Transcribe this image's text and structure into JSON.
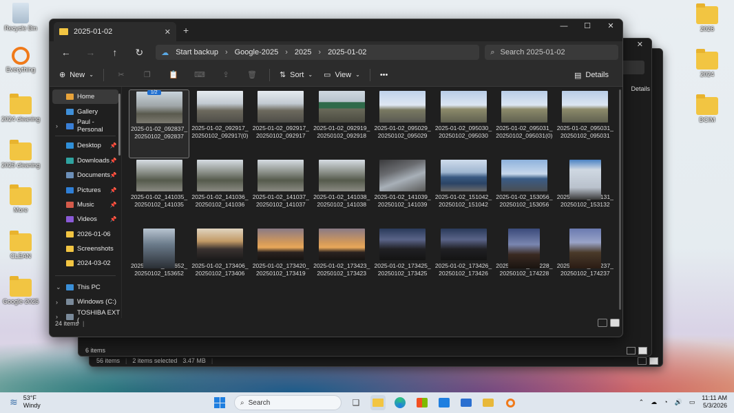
{
  "desktop_icons": [
    {
      "label": "Recycle Bin",
      "type": "recycle"
    },
    {
      "label": "Everything",
      "type": "app"
    },
    {
      "label": "2024 cleaning",
      "type": "folder"
    },
    {
      "label": "2025 cleaning",
      "type": "folder"
    },
    {
      "label": "More",
      "type": "folder"
    },
    {
      "label": "CLEAN",
      "type": "folder"
    },
    {
      "label": "Google-2025",
      "type": "folder"
    },
    {
      "label": "2026",
      "type": "folder"
    },
    {
      "label": "2024",
      "type": "folder"
    },
    {
      "label": "DCIM",
      "type": "folder"
    }
  ],
  "window": {
    "tab_title": "2025-01-02",
    "breadcrumbs": [
      "Start backup",
      "Google-2025",
      "2025",
      "2025-01-02"
    ],
    "search_placeholder": "Search 2025-01-02",
    "toolbar": {
      "new": "New",
      "sort": "Sort",
      "view": "View",
      "more": "•••",
      "details": "Details"
    },
    "status": "24 items"
  },
  "nav": {
    "pinned": [
      {
        "label": "Home",
        "selected": true,
        "color": "#e8a33a"
      },
      {
        "label": "Gallery",
        "color": "#3f8fd8"
      },
      {
        "label": "Paul - Personal",
        "color": "#3a7fd6",
        "expand": true
      }
    ],
    "quick": [
      {
        "label": "Desktop",
        "color": "#2f8fd8",
        "pin": true
      },
      {
        "label": "Downloads",
        "color": "#2fa3a0",
        "pin": true
      },
      {
        "label": "Documents",
        "color": "#6c8fb8",
        "pin": true
      },
      {
        "label": "Pictures",
        "color": "#2f7fd6",
        "pin": true
      },
      {
        "label": "Music",
        "color": "#d45a4a",
        "pin": true
      },
      {
        "label": "Videos",
        "color": "#8a5ad6",
        "pin": true
      },
      {
        "label": "2026-01-06",
        "color": "#f2c542"
      },
      {
        "label": "Screenshots",
        "color": "#f2c542"
      },
      {
        "label": "2024-03-02",
        "color": "#f2c542"
      }
    ],
    "drives": [
      {
        "label": "This PC",
        "color": "#3a8fd8",
        "expand": "open"
      },
      {
        "label": "Windows (C:)",
        "color": "#7a8a9a",
        "expand": true
      },
      {
        "label": "TOSHIBA EXT (",
        "color": "#7a8a9a",
        "expand": true
      }
    ]
  },
  "files": [
    {
      "name": "2025-01-02_092837_20250102_092837",
      "scene": "trees",
      "selected": true,
      "badge": "1/2"
    },
    {
      "name": "2025-01-02_092917_20250102_092917(0)",
      "scene": "highway"
    },
    {
      "name": "2025-01-02_092917_20250102_092917",
      "scene": "highway"
    },
    {
      "name": "2025-01-02_092919_20250102_092918",
      "scene": "sign"
    },
    {
      "name": "2025-01-02_095029_20250102_095029",
      "scene": "road-green"
    },
    {
      "name": "2025-01-02_095030_20250102_095030",
      "scene": "field"
    },
    {
      "name": "2025-01-02_095031_20250102_095031(0)",
      "scene": "field"
    },
    {
      "name": "2025-01-02_095031_20250102_095031",
      "scene": "field"
    },
    {
      "name": "2025-01-02_141035_20250102_141035",
      "scene": "trees2"
    },
    {
      "name": "2025-01-02_141036_20250102_141036",
      "scene": "trees2"
    },
    {
      "name": "2025-01-02_141037_20250102_141037",
      "scene": "trees2"
    },
    {
      "name": "2025-01-02_141038_20250102_141038",
      "scene": "trees2"
    },
    {
      "name": "2025-01-02_141039_20250102_141039",
      "scene": "car"
    },
    {
      "name": "2025-01-02_151042_20250102_151042",
      "scene": "water"
    },
    {
      "name": "2025-01-02_153056_20250102_153056",
      "scene": "water2"
    },
    {
      "name": "2025-01-02_153131_20250102_153132",
      "scene": "truck",
      "portrait": true
    },
    {
      "name": "2025-01-02_153652_20250102_153652",
      "scene": "mirror",
      "portrait": true
    },
    {
      "name": "2025-01-02_173406_20250102_173406",
      "scene": "city-dusk"
    },
    {
      "name": "2025-01-02_173420_20250102_173419",
      "scene": "skyline"
    },
    {
      "name": "2025-01-02_173423_20250102_173423",
      "scene": "skyline"
    },
    {
      "name": "2025-01-02_173425_20250102_173425",
      "scene": "night-city"
    },
    {
      "name": "2025-01-02_173426_20250102_173426",
      "scene": "night-city"
    },
    {
      "name": "2025-01-02_174228_20250102_174228",
      "scene": "xmas",
      "portrait": true
    },
    {
      "name": "2025-01-02_174237_20250102_174237",
      "scene": "xmas2",
      "portrait": true
    }
  ],
  "bg_windows": [
    {
      "status": "6 items"
    },
    {
      "status": "56 items",
      "selected": "2 items selected",
      "size": "3.47 MB",
      "details": "Details"
    }
  ],
  "taskbar": {
    "temp": "53°F",
    "condition": "Windy",
    "search": "Search",
    "time": "11:11 AM",
    "date": "5/3/2026"
  }
}
